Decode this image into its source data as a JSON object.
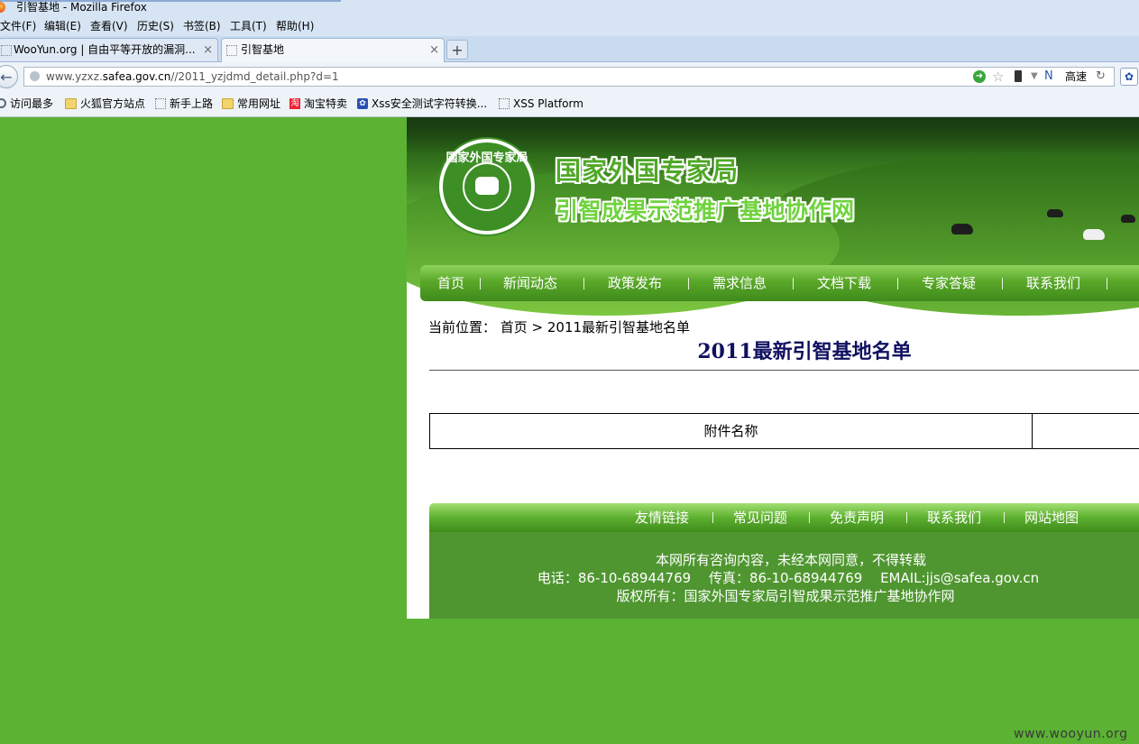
{
  "window": {
    "title": "引智基地 - Mozilla Firefox"
  },
  "menu": [
    "文件(F)",
    "编辑(E)",
    "查看(V)",
    "历史(S)",
    "书签(B)",
    "工具(T)",
    "帮助(H)"
  ],
  "tabs": [
    {
      "label": "WooYun.org | 自由平等开放的漏洞...",
      "close": "×"
    },
    {
      "label": "引智基地",
      "close": "×"
    }
  ],
  "newtab": "+",
  "navbar": {
    "url_prefix": "www.yzxz.",
    "url_domain": "safea.gov.cn",
    "url_path": "//2011_yzjdmd_detail.php?d=1",
    "speed_label": "高速"
  },
  "bookmarks": [
    "访问最多",
    "火狐官方站点",
    "新手上路",
    "常用网址",
    "淘宝特卖",
    "Xss安全测试字符转换...",
    "XSS Platform"
  ],
  "site": {
    "seal_text": "国家外国专家局",
    "org_name": "国家外国专家局",
    "site_name": "引智成果示范推广基地协作网",
    "nav": [
      "首页",
      "新闻动态",
      "政策发布",
      "需求信息",
      "文档下载",
      "专家答疑",
      "联系我们"
    ],
    "breadcrumb": "当前位置： 首页 > 2011最新引智基地名单",
    "title": "2011最新引智基地名单",
    "table_header": "附件名称",
    "footer_nav": [
      "友情链接",
      "常见问题",
      "免责声明",
      "联系我们",
      "网站地图"
    ],
    "footer_lines": [
      "本网所有咨询内容，未经本网同意，不得转载",
      "电话：86-10-68944769　 传真：86-10-68944769　 EMAIL:jjs@safea.gov.cn",
      "版权所有：国家外国专家局引智成果示范推广基地协作网"
    ]
  },
  "watermark": "www.wooyun.org",
  "colors": {
    "page_background": "#5bb233",
    "nav_green": "#5aa829",
    "title_navy": "#101060"
  }
}
